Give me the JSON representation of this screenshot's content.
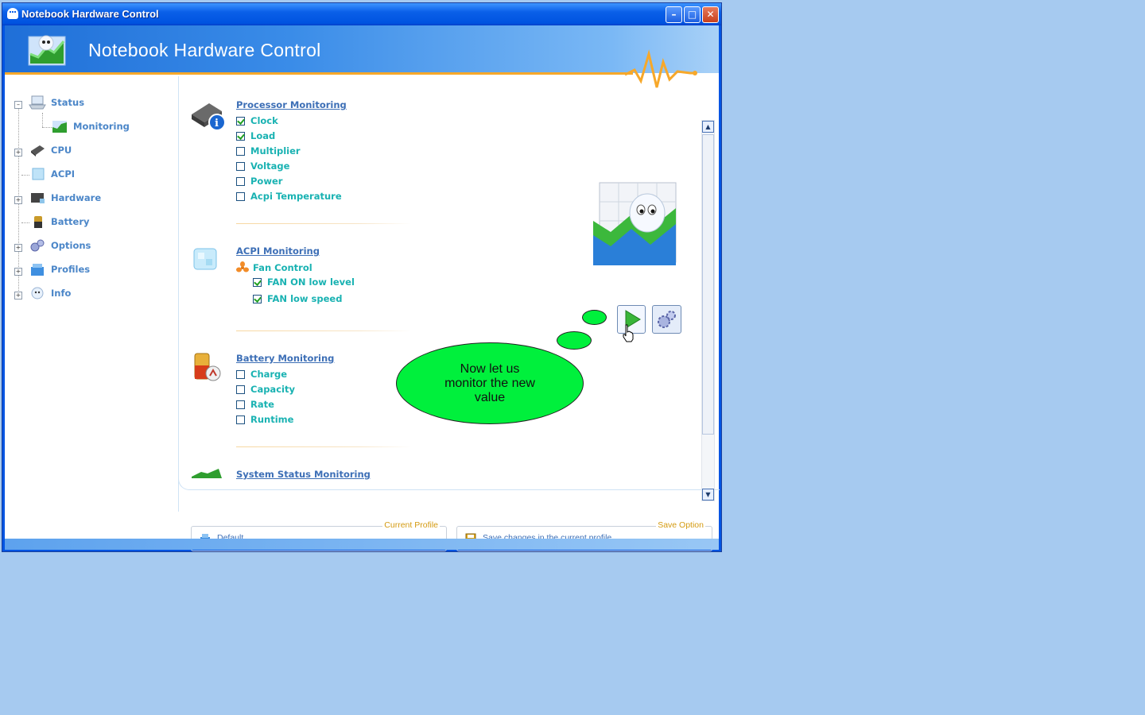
{
  "window": {
    "title": "Notebook Hardware Control",
    "banner_title": "Notebook Hardware Control"
  },
  "tree": {
    "items": [
      {
        "label": "Status",
        "icon": "laptop-icon"
      },
      {
        "label": "Monitoring",
        "icon": "monitoring-chart-icon"
      },
      {
        "label": "CPU",
        "icon": "cpu-chip-icon"
      },
      {
        "label": "ACPI",
        "icon": "acpi-cube-icon"
      },
      {
        "label": "Hardware",
        "icon": "hardware-board-icon"
      },
      {
        "label": "Battery",
        "icon": "battery-icon"
      },
      {
        "label": "Options",
        "icon": "gears-icon"
      },
      {
        "label": "Profiles",
        "icon": "profiles-icon"
      },
      {
        "label": "Info",
        "icon": "info-ghost-icon"
      }
    ]
  },
  "processor": {
    "title": "Processor Monitoring",
    "items": [
      {
        "label": "Clock",
        "checked": true
      },
      {
        "label": "Load",
        "checked": true
      },
      {
        "label": "Multiplier",
        "checked": false
      },
      {
        "label": "Voltage",
        "checked": false
      },
      {
        "label": "Power",
        "checked": false
      },
      {
        "label": "Acpi Temperature",
        "checked": false
      }
    ]
  },
  "acpi": {
    "title": "ACPI Monitoring",
    "fan_control": "Fan Control",
    "items": [
      {
        "label": "FAN ON low level",
        "checked": true
      },
      {
        "label": "FAN low speed",
        "checked": true
      }
    ]
  },
  "battery": {
    "title": "Battery Monitoring",
    "items": [
      {
        "label": "Charge",
        "checked": false
      },
      {
        "label": "Capacity",
        "checked": false
      },
      {
        "label": "Rate",
        "checked": false
      },
      {
        "label": "Runtime",
        "checked": false
      }
    ]
  },
  "system": {
    "title": "System Status Monitoring"
  },
  "bubble": {
    "line1": "Now let us",
    "line2": "monitor the new",
    "line3": "value"
  },
  "current_profile": {
    "label": "Current Profile",
    "value": "Default"
  },
  "save_option": {
    "label": "Save Option",
    "value": "Save changes in the current profile"
  },
  "colors": {
    "accent": "#3d6fb6",
    "checkbox_text": "#19b2b2",
    "bubble": "#00f03c",
    "banner_line": "#f7a82a"
  }
}
